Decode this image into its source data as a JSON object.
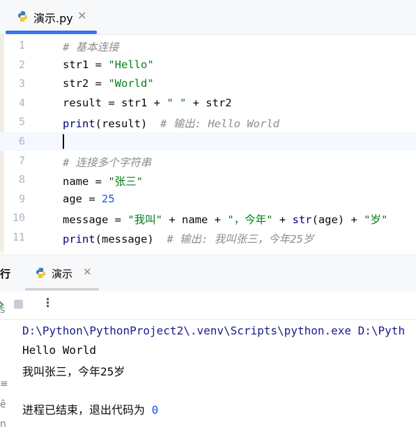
{
  "editor_tab": {
    "label": "演示.py",
    "close": "✕"
  },
  "editor_lines": [
    {
      "num": "1",
      "parts": [
        {
          "t": "# 基本连接",
          "c": "cmt"
        }
      ]
    },
    {
      "num": "2",
      "parts": [
        {
          "t": "str1 = ",
          "c": ""
        },
        {
          "t": "\"Hello\"",
          "c": "str"
        }
      ]
    },
    {
      "num": "3",
      "parts": [
        {
          "t": "str2 = ",
          "c": ""
        },
        {
          "t": "\"World\"",
          "c": "str"
        }
      ]
    },
    {
      "num": "4",
      "parts": [
        {
          "t": "result = str1 + ",
          "c": ""
        },
        {
          "t": "\" \"",
          "c": "str"
        },
        {
          "t": " + str2",
          "c": ""
        }
      ]
    },
    {
      "num": "5",
      "parts": [
        {
          "t": "print",
          "c": "bi"
        },
        {
          "t": "(result)  ",
          "c": ""
        },
        {
          "t": "# 输出: Hello World",
          "c": "cmt"
        }
      ]
    },
    {
      "num": "6",
      "parts": [],
      "current": true
    },
    {
      "num": "7",
      "parts": [
        {
          "t": "# 连接多个字符串",
          "c": "cmt"
        }
      ]
    },
    {
      "num": "8",
      "parts": [
        {
          "t": "name = ",
          "c": ""
        },
        {
          "t": "\"张三\"",
          "c": "str"
        }
      ]
    },
    {
      "num": "9",
      "parts": [
        {
          "t": "age = ",
          "c": ""
        },
        {
          "t": "25",
          "c": "num"
        }
      ]
    },
    {
      "num": "10",
      "parts": [
        {
          "t": "message = ",
          "c": ""
        },
        {
          "t": "\"我叫\"",
          "c": "str"
        },
        {
          "t": " + name + ",
          "c": ""
        },
        {
          "t": "\"，今年\"",
          "c": "str"
        },
        {
          "t": " + ",
          "c": ""
        },
        {
          "t": "str",
          "c": "bi"
        },
        {
          "t": "(age) + ",
          "c": ""
        },
        {
          "t": "\"岁\"",
          "c": "str"
        }
      ]
    },
    {
      "num": "11",
      "parts": [
        {
          "t": "print",
          "c": "bi"
        },
        {
          "t": "(message)  ",
          "c": ""
        },
        {
          "t": "# 输出: 我叫张三，今年25岁",
          "c": "cmt"
        }
      ]
    }
  ],
  "run_panel": {
    "title": "行",
    "tab_label": "演示",
    "close": "✕",
    "more": "⋮"
  },
  "console": {
    "command": "D:\\Python\\PythonProject2\\.venv\\Scripts\\python.exe D:\\Pyth",
    "out1": "Hello World",
    "out2": "我叫张三，今年25岁",
    "exit_text": "进程已结束，退出代码为 ",
    "exit_code": "0",
    "side_glyphs": [
      "s",
      "≡",
      "ê",
      "n"
    ]
  },
  "colors": {
    "accent": "#3574f0",
    "string": "#067d17",
    "number": "#1750eb",
    "builtin": "#000080",
    "comment": "#8c8c8c"
  }
}
